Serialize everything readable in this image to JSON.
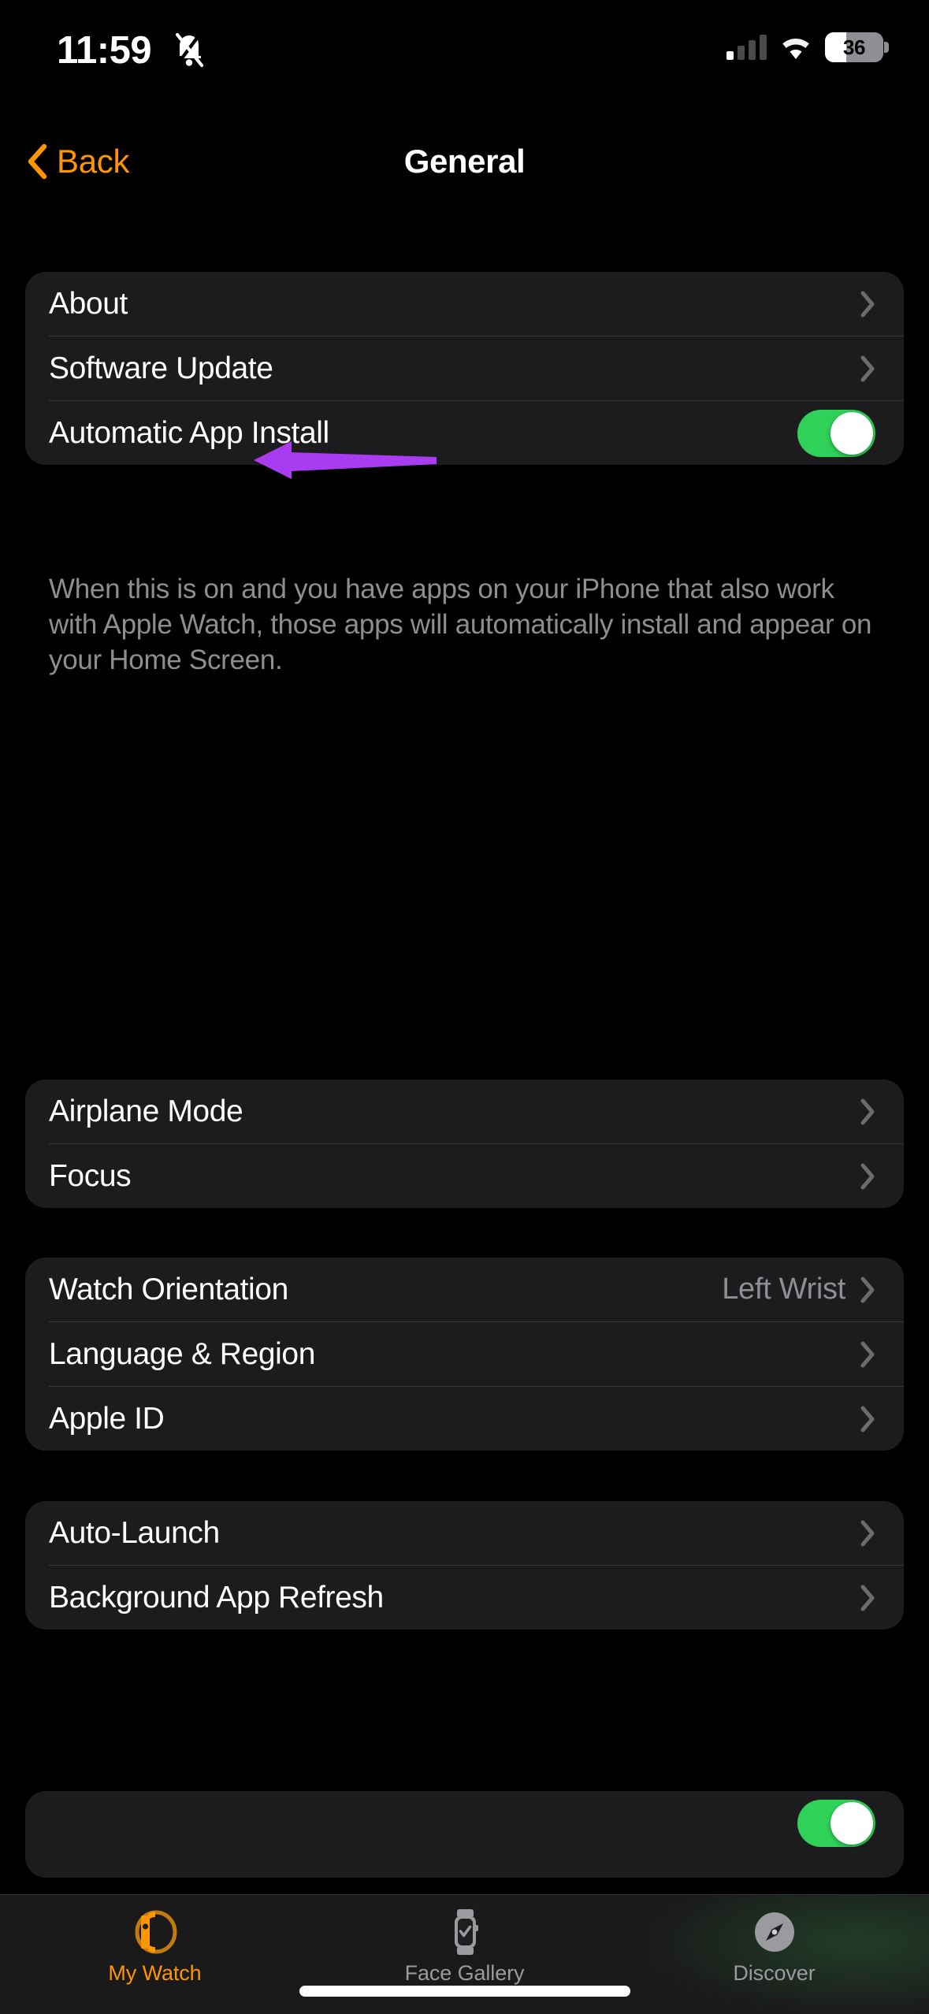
{
  "status_bar": {
    "time": "11:59",
    "silent_icon": "bell-slash-icon",
    "cellular_icon": "cellular-signal-icon",
    "wifi_icon": "wifi-icon",
    "battery_percent": "36",
    "battery_level": 36
  },
  "nav": {
    "back_label": "Back",
    "back_icon": "chevron-left-icon",
    "title": "General",
    "accent_color": "#FF9500"
  },
  "groups": [
    {
      "id": "group-updates",
      "rows": [
        {
          "label": "About",
          "type": "disclosure",
          "accessory": "chevron-right-icon"
        },
        {
          "label": "Software Update",
          "type": "disclosure",
          "accessory": "chevron-right-icon",
          "annotated": true
        },
        {
          "label": "Automatic App Install",
          "type": "toggle",
          "toggle_on": true,
          "toggle_color": "#30D158"
        }
      ],
      "footnote": "When this is on and you have apps on your iPhone that also work with Apple Watch, those apps will automatically install and appear on your Home Screen."
    },
    {
      "id": "group-connectivity",
      "rows": [
        {
          "label": "Airplane Mode",
          "type": "disclosure",
          "accessory": "chevron-right-icon"
        },
        {
          "label": "Focus",
          "type": "disclosure",
          "accessory": "chevron-right-icon"
        }
      ]
    },
    {
      "id": "group-device",
      "rows": [
        {
          "label": "Watch Orientation",
          "type": "disclosure",
          "value": "Left Wrist",
          "accessory": "chevron-right-icon"
        },
        {
          "label": "Language & Region",
          "type": "disclosure",
          "accessory": "chevron-right-icon"
        },
        {
          "label": "Apple ID",
          "type": "disclosure",
          "accessory": "chevron-right-icon"
        }
      ]
    },
    {
      "id": "group-apps",
      "rows": [
        {
          "label": "Auto-Launch",
          "type": "disclosure",
          "accessory": "chevron-right-icon"
        },
        {
          "label": "Background App Refresh",
          "type": "disclosure",
          "accessory": "chevron-right-icon"
        }
      ]
    },
    {
      "id": "group-partial",
      "rows": [
        {
          "label": "",
          "type": "toggle",
          "toggle_on": true,
          "toggle_color": "#30D158"
        }
      ]
    }
  ],
  "annotation": {
    "type": "arrow",
    "color": "#A93BF0",
    "points_to": "Software Update",
    "direction": "left"
  },
  "tabbar": {
    "items": [
      {
        "label": "My Watch",
        "icon": "apple-watch-side-icon",
        "active": true
      },
      {
        "label": "Face Gallery",
        "icon": "watch-face-check-icon",
        "active": false
      },
      {
        "label": "Discover",
        "icon": "compass-icon",
        "active": false
      }
    ],
    "active_color": "#FF9500",
    "inactive_color": "#9A9A9F"
  },
  "home_indicator": "home-indicator"
}
